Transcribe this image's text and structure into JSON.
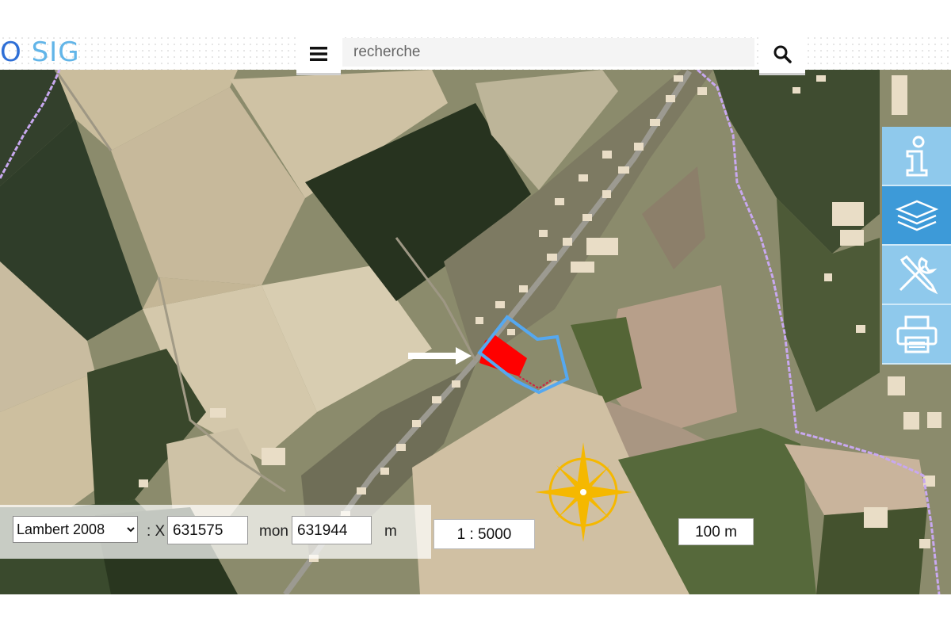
{
  "header": {
    "logo_part1": "O",
    "logo_part2": "SIG",
    "menu_icon": "hamburger-menu-icon",
    "search_placeholder": "recherche",
    "search_icon": "magnifier-icon"
  },
  "toolbar": {
    "items": [
      {
        "icon": "info-icon",
        "active": false
      },
      {
        "icon": "layers-icon",
        "active": true
      },
      {
        "icon": "tools-icon",
        "active": false
      },
      {
        "icon": "printer-icon",
        "active": false
      }
    ]
  },
  "coordinates": {
    "crs_selected": "Lambert 2008",
    "x_label": ": X",
    "x_value": "631575",
    "y_label": "mon",
    "y_value": "631944",
    "unit": "m"
  },
  "scale": {
    "ratio": "1 : 5000",
    "bar_label": "100 m"
  },
  "map": {
    "compass_icon": "compass-rose-icon",
    "pointer_icon": "arrow-pointer-icon",
    "colors": {
      "parcel_highlight": "#ff0000",
      "selection_outline": "#55a8f0",
      "boundary_line": "#c8a8f0",
      "compass": "#f5b800",
      "toolbar_bg": "#8fc9ec",
      "toolbar_active": "#3d9ad8"
    }
  }
}
